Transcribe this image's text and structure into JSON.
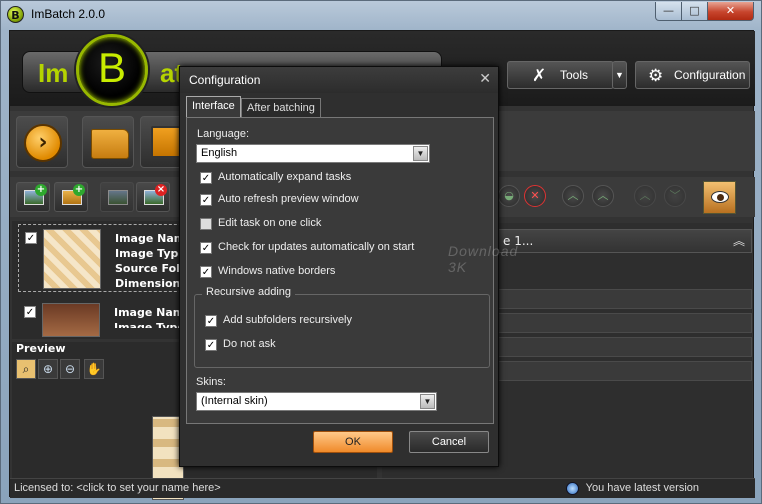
{
  "window": {
    "title": "ImBatch 2.0.0",
    "app_icon_letter": "B"
  },
  "caption": {
    "minimize": "—",
    "maximize": "□",
    "close": "✕"
  },
  "logo": {
    "left": "Im",
    "middle": "B",
    "right": "at"
  },
  "toolbar": {
    "tools_label": "Tools",
    "configuration_label": "Configuration",
    "tools_icon": "wrench-icon",
    "config_icon": "gear-icon"
  },
  "tasks": [
    {
      "lines": [
        "Image Name:",
        "Image Type:",
        "Source Folde",
        "Dimensions:"
      ],
      "checked": true
    },
    {
      "lines": [
        "Image Name:",
        "Image Type:"
      ],
      "checked": true
    }
  ],
  "preview": {
    "title": "Preview"
  },
  "right_panel": {
    "header": "e 1..."
  },
  "status": {
    "left": "Licensed to:  <click to set your name here>",
    "right": "You have latest version"
  },
  "dialog": {
    "title": "Configuration",
    "tabs": [
      {
        "label": "Interface"
      },
      {
        "label": "After batching"
      }
    ],
    "language_label": "Language:",
    "language_value": "English",
    "options": [
      {
        "label": "Automatically expand tasks",
        "checked": true
      },
      {
        "label": "Auto refresh preview window",
        "checked": true
      },
      {
        "label": "Edit task on one click",
        "checked": false
      },
      {
        "label": "Check for updates automatically on start",
        "checked": true
      },
      {
        "label": "Windows native borders",
        "checked": true
      }
    ],
    "recursive_group_title": "Recursive adding",
    "recursive_options": [
      {
        "label": "Add subfolders recursively",
        "checked": true
      },
      {
        "label": "Do not ask",
        "checked": true
      }
    ],
    "skins_label": "Skins:",
    "skins_value": "(Internal skin)",
    "ok_label": "OK",
    "cancel_label": "Cancel"
  },
  "watermark": "Download 3K",
  "colors": {
    "accent": "#c8ec00",
    "ok_button": "#f08a2a"
  }
}
